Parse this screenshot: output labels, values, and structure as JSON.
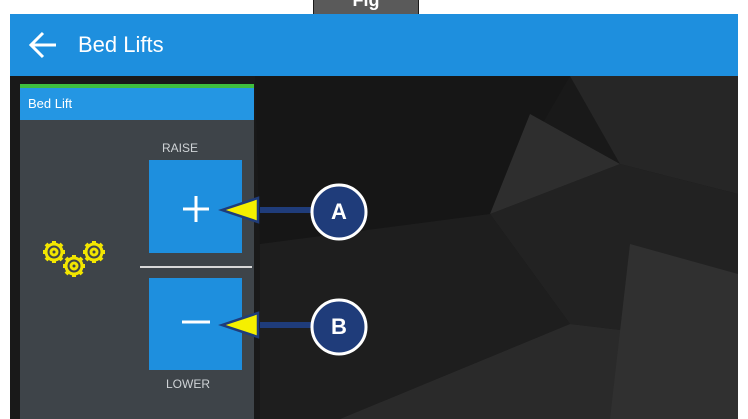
{
  "top_tab": {
    "label": "Fig"
  },
  "header": {
    "title": "Bed Lifts",
    "back_icon": "arrow-left-icon"
  },
  "panel": {
    "title": "Bed Lift",
    "gear_icon": "gears-icon",
    "raise_label": "RAISE",
    "lower_label": "LOWER",
    "raise_button_symbol": "+",
    "lower_button_symbol": "−"
  },
  "callouts": [
    {
      "letter": "A",
      "target": "raise-button"
    },
    {
      "letter": "B",
      "target": "lower-button"
    }
  ],
  "colors": {
    "header_blue": "#1e8fde",
    "accent_green": "#3fbf3f",
    "gear_yellow": "#f2e600",
    "callout_navy": "#1f3c7a",
    "arrow_yellow": "#f5f000",
    "panel_bg": "#3e4449"
  }
}
